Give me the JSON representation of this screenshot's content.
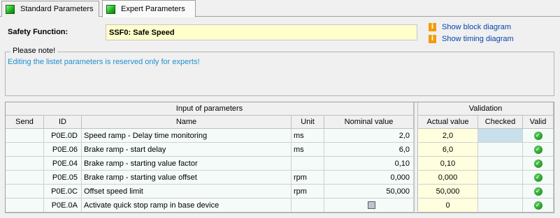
{
  "tabs": [
    {
      "label": "Standard Parameters"
    },
    {
      "label": "Expert Parameters"
    }
  ],
  "safety": {
    "label": "Safety Function:",
    "value": "SSF0: Safe Speed"
  },
  "links": {
    "block_diagram": "Show block diagram",
    "timing_diagram": "Show timing diagram"
  },
  "note": {
    "title": "Please note!",
    "text": "Editing the listet parameters is reserved only for experts!"
  },
  "grid": {
    "group_input": "Input of parameters",
    "group_validation": "Validation",
    "headers": {
      "send": "Send",
      "id": "ID",
      "name": "Name",
      "unit": "Unit",
      "nominal": "Nominal value",
      "actual": "Actual value",
      "checked": "Checked",
      "valid": "Valid"
    },
    "rows": [
      {
        "id": "P0E.0D",
        "name": "Speed ramp - Delay time monitoring",
        "unit": "ms",
        "nominal": "2,0",
        "actual": "2,0",
        "valid": true,
        "nominal_checkbox": false
      },
      {
        "id": "P0E.06",
        "name": "Brake ramp - start delay",
        "unit": "ms",
        "nominal": "6,0",
        "actual": "6,0",
        "valid": true,
        "nominal_checkbox": false
      },
      {
        "id": "P0E.04",
        "name": "Brake ramp - starting value factor",
        "unit": "",
        "nominal": "0,10",
        "actual": "0,10",
        "valid": true,
        "nominal_checkbox": false
      },
      {
        "id": "P0E.05",
        "name": "Brake ramp - starting value offset",
        "unit": "rpm",
        "nominal": "0,000",
        "actual": "0,000",
        "valid": true,
        "nominal_checkbox": false
      },
      {
        "id": "P0E.0C",
        "name": "Offset speed limit",
        "unit": "rpm",
        "nominal": "50,000",
        "actual": "50,000",
        "valid": true,
        "nominal_checkbox": false
      },
      {
        "id": "P0E.0A",
        "name": "Activate quick stop ramp in base device",
        "unit": "",
        "nominal": "",
        "actual": "0",
        "valid": true,
        "nominal_checkbox": true
      }
    ]
  },
  "colors": {
    "link": "#0645ad",
    "note_text": "#1f8fd0",
    "field_bg": "#ffffcc",
    "valid_green": "#128012"
  }
}
